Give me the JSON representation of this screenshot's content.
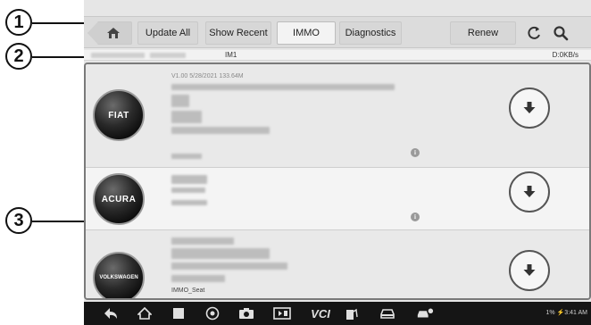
{
  "callouts": [
    "1",
    "2",
    "3"
  ],
  "toolbar": {
    "buttons": [
      "Update All",
      "Show Recent",
      "IMMO",
      "Diagnostics",
      "Renew"
    ],
    "active": "IMMO",
    "icons": [
      "home-icon",
      "refresh-icon",
      "search-icon"
    ]
  },
  "status": {
    "name": "IM1",
    "speed": "D:0KB/s"
  },
  "rows": [
    {
      "brand": "FIAT",
      "meta": "V1.00   5/28/2021   133.64M",
      "icon": "download-icon"
    },
    {
      "brand": "ACURA",
      "meta": "",
      "icon": "download-icon"
    },
    {
      "brand": "VOLKSWAGEN",
      "meta": "",
      "footer": "IMMO_Seat",
      "icon": "download-icon"
    }
  ],
  "nav": {
    "icons": [
      "back-icon",
      "home-icon",
      "recents-icon",
      "browser-icon",
      "camera-icon",
      "screen-record-icon",
      "vci-icon",
      "fuel-icon",
      "car-icon",
      "car-settings-icon"
    ],
    "vci_label": "VCI",
    "system_status": "1% ⚡3:41 AM"
  },
  "colors": {
    "toolbar": "#dcdcdc",
    "active_tab": "#f3f3f3",
    "navbar": "#151515",
    "row_light": "#f4f4f4",
    "row_dark": "#e9e9e9"
  }
}
